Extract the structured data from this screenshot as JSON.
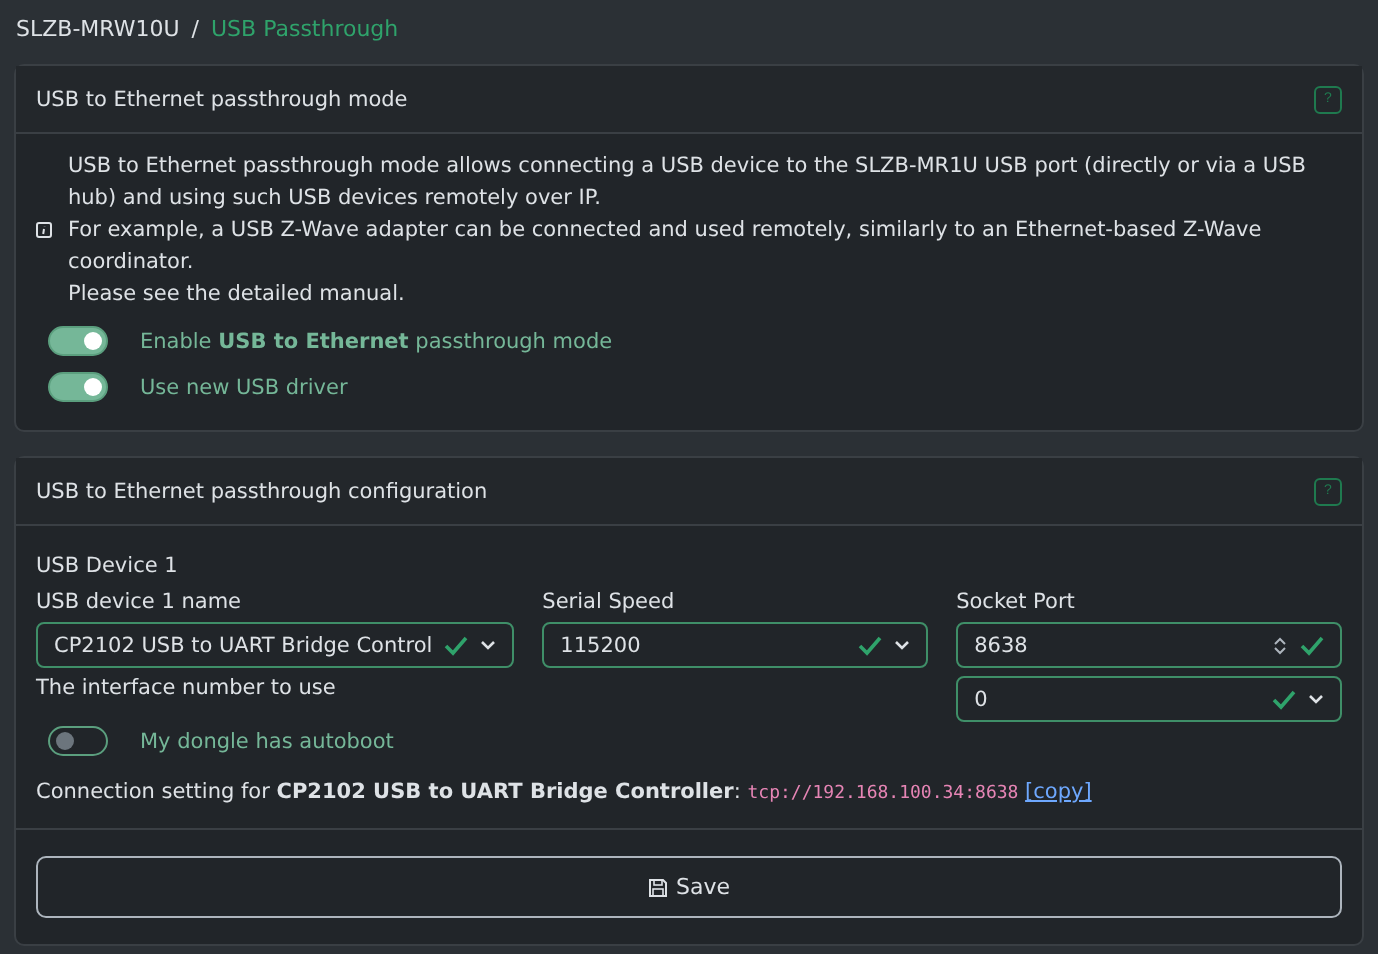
{
  "breadcrumb": [
    {
      "label": "SLZB-MRW10U",
      "selected": false
    },
    {
      "label": "USB Passthrough",
      "selected": true
    }
  ],
  "breadcrumb_separator": "/",
  "mode_card": {
    "title": "USB to Ethernet passthrough mode",
    "help": "?",
    "info": [
      "USB to Ethernet passthrough mode allows connecting a USB device to the SLZB-MR1U USB port (directly or via a USB hub) and using such USB devices remotely over IP.",
      "For example, a USB Z-Wave adapter can be connected and used remotely, similarly to an Ethernet-based Z-Wave coordinator.",
      "Please see the detailed manual."
    ],
    "switches": [
      {
        "label": "Enable **USB to Ethernet** passthrough mode",
        "on": true
      },
      {
        "label": "Use new USB driver",
        "on": true
      }
    ]
  },
  "config_card": {
    "title": "USB to Ethernet passthrough configuration",
    "help": "?",
    "device_heading": "USB Device 1",
    "fields": [
      {
        "label": "USB device 1 name",
        "kind": "select",
        "value": "CP2102 USB to UART Bridge Control",
        "valid": true
      },
      {
        "label": "Serial Speed",
        "kind": "select",
        "value": "115200",
        "valid": true
      },
      {
        "label": "Socket Port",
        "kind": "number",
        "value": "8638",
        "valid": true
      }
    ],
    "interface": {
      "label": "The interface number to use",
      "kind": "select",
      "value": "0",
      "valid": true
    },
    "switches": [
      {
        "label": "My dongle has autoboot",
        "on": false
      }
    ],
    "connection": {
      "text": "Connection setting for **CP2102 USB to UART Bridge Controller**:",
      "address": "tcp://192.168.100.34:8638",
      "link": "[copy]"
    },
    "save": "Save"
  }
}
